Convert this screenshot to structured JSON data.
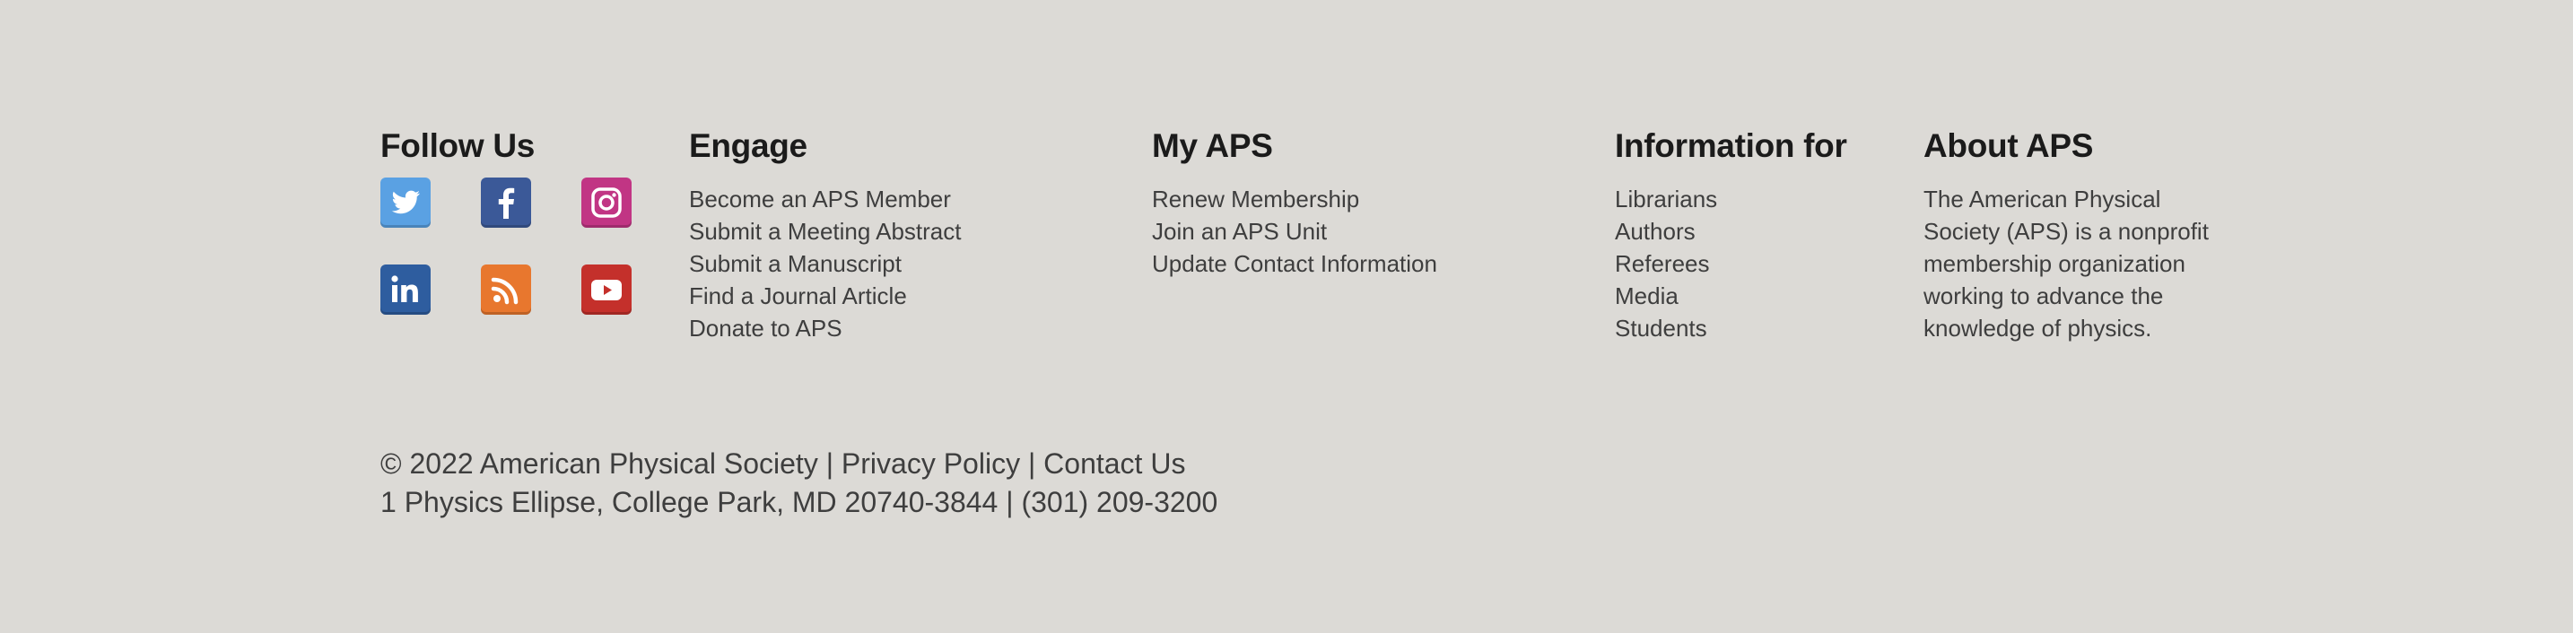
{
  "follow": {
    "heading": "Follow Us",
    "icons": [
      {
        "name": "twitter-icon",
        "color": "#5aa1e3"
      },
      {
        "name": "facebook-icon",
        "color": "#3b5998"
      },
      {
        "name": "instagram-icon",
        "color": "#c13584"
      },
      {
        "name": "linkedin-icon",
        "color": "#2e5d9f"
      },
      {
        "name": "rss-icon",
        "color": "#e8772e"
      },
      {
        "name": "youtube-icon",
        "color": "#c4302b"
      }
    ]
  },
  "engage": {
    "heading": "Engage",
    "links": [
      "Become an APS Member",
      "Submit a Meeting Abstract",
      "Submit a Manuscript",
      "Find a Journal Article",
      "Donate to APS"
    ]
  },
  "my_aps": {
    "heading": "My APS",
    "links": [
      "Renew Membership",
      "Join an APS Unit",
      "Update Contact Information"
    ]
  },
  "information_for": {
    "heading": "Information for",
    "links": [
      "Librarians",
      "Authors",
      "Referees",
      "Media",
      "Students"
    ]
  },
  "about": {
    "heading": "About APS",
    "text": "The American Physical Society (APS) is a nonprofit membership organization working to advance the knowledge of physics."
  },
  "footer": {
    "copyright": "© 2022 American Physical Society",
    "separator": " | ",
    "privacy": "Privacy Policy",
    "contact": "Contact Us",
    "address": "1 Physics Ellipse, College Park, MD 20740-3844 | (301) 209-3200"
  }
}
